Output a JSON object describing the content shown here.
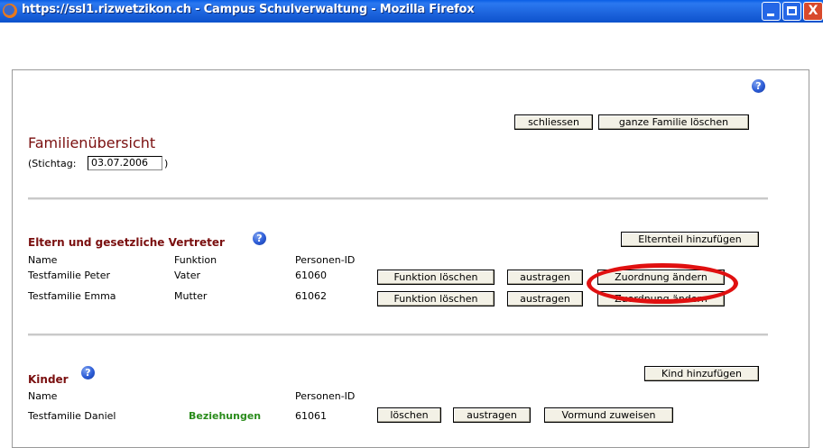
{
  "window": {
    "title": "https://ssl1.rizwetzikon.ch - Campus Schulverwaltung - Mozilla Firefox",
    "controls": {
      "minimize": "minimize",
      "maximize": "maximize",
      "close": "X"
    }
  },
  "header": {
    "help": "?",
    "close_button": "schliessen",
    "delete_family_button": "ganze Familie löschen",
    "title": "Familienübersicht",
    "stichtag_label": "(Stichtag:",
    "stichtag_close": ")",
    "stichtag_value": "03.07.2006"
  },
  "parents": {
    "title": "Eltern und gesetzliche Vertreter",
    "help": "?",
    "add_button": "Elternteil hinzufügen",
    "columns": {
      "name": "Name",
      "funktion": "Funktion",
      "personen_id": "Personen-ID"
    },
    "rows": [
      {
        "name": "Testfamilie Peter",
        "funktion": "Vater",
        "personen_id": "61060",
        "delete_function_button": "Funktion löschen",
        "remove_button": "austragen",
        "change_assignment_button": "Zuordnung ändern"
      },
      {
        "name": "Testfamilie Emma",
        "funktion": "Mutter",
        "personen_id": "61062",
        "delete_function_button": "Funktion löschen",
        "remove_button": "austragen",
        "change_assignment_button": "Zuordnung ändern"
      }
    ]
  },
  "children": {
    "title": "Kinder",
    "help": "?",
    "add_button": "Kind hinzufügen",
    "columns": {
      "name": "Name",
      "personen_id": "Personen-ID"
    },
    "rows": [
      {
        "name": "Testfamilie Daniel",
        "relations_link": "Beziehungen",
        "personen_id": "61061",
        "delete_button": "löschen",
        "remove_button": "austragen",
        "guardian_button": "Vormund zuweisen"
      }
    ]
  },
  "annotation": {
    "highlight_color": "#e01010"
  }
}
